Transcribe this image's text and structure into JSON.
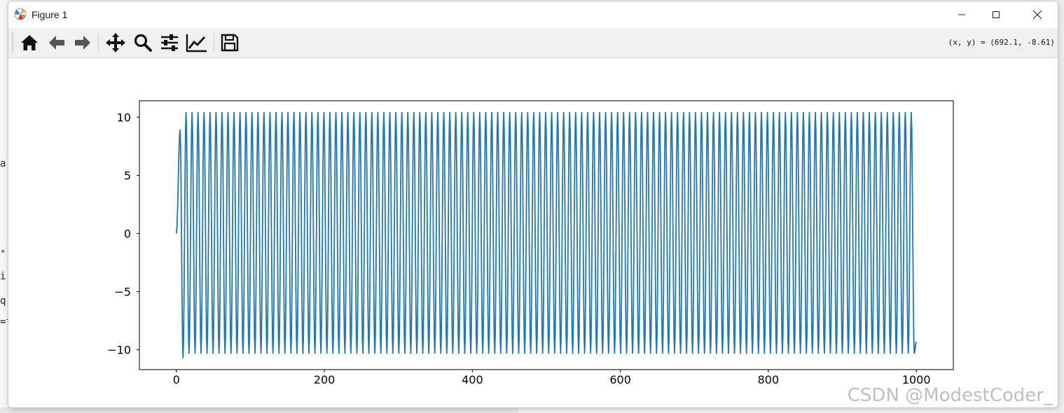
{
  "window": {
    "title": "Figure 1",
    "icon": "matplotlib-icon",
    "controls": [
      "minimize-icon",
      "maximize-icon",
      "close-icon"
    ]
  },
  "toolbar": {
    "buttons": [
      {
        "name": "home-button",
        "icon": "home-icon"
      },
      {
        "name": "back-button",
        "icon": "arrow-left-icon"
      },
      {
        "name": "forward-button",
        "icon": "arrow-right-icon"
      },
      {
        "name": "pan-button",
        "icon": "move-icon"
      },
      {
        "name": "zoom-button",
        "icon": "magnifier-icon"
      },
      {
        "name": "subplots-button",
        "icon": "sliders-icon"
      },
      {
        "name": "edit-axis-button",
        "icon": "line-chart-icon"
      },
      {
        "name": "save-button",
        "icon": "floppy-disk-icon"
      }
    ],
    "coords": "(x, y) = (692.1, -8.61)"
  },
  "background_glyphs": [
    "a,",
    "•",
    "i",
    "q",
    "=t"
  ],
  "watermark": "CSDN @ModestCoder_",
  "colors": {
    "line": "#1f77b4",
    "axes": "#000000"
  },
  "chart_data": {
    "type": "line",
    "title": "",
    "xlabel": "",
    "ylabel": "",
    "xlim": [
      -50,
      1050
    ],
    "ylim": [
      -11.7,
      11.4
    ],
    "xticks": [
      0,
      200,
      400,
      600,
      800,
      1000
    ],
    "yticks": [
      -10,
      -5,
      0,
      5,
      10
    ],
    "xtick_labels": [
      "0",
      "200",
      "400",
      "600",
      "800",
      "1000"
    ],
    "ytick_labels": [
      "−10",
      "−5",
      "0",
      "5",
      "10"
    ],
    "grid": false,
    "legend": "none",
    "series": [
      {
        "description": "oscillating signal, x from 0 to 1000",
        "start": [
          0,
          0
        ],
        "first_peak": [
          5,
          8.9
        ],
        "first_trough": [
          9,
          -10.7
        ],
        "amplitude_max": 10.4,
        "amplitude_min": -10.3,
        "period": 8.1,
        "end": [
          1000,
          -9.3
        ]
      }
    ]
  }
}
